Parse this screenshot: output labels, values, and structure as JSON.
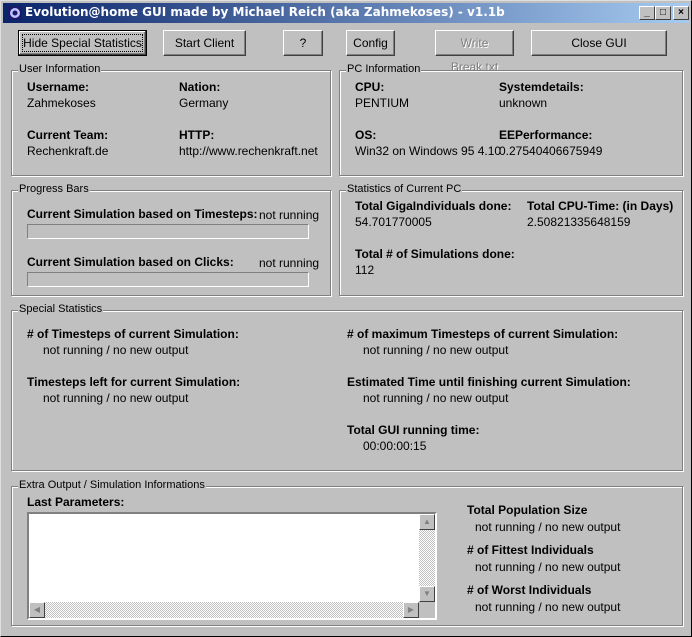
{
  "window": {
    "title": "Evolution@home GUI made by Michael Reich (aka Zahmekoses) - v1.1b",
    "controls": {
      "minimize": "_",
      "maximize": "□",
      "close": "×"
    }
  },
  "toolbar": {
    "hide_special_stats": "Hide Special Statistics",
    "start_client": "Start Client",
    "help": "?",
    "config": "Config",
    "write_break": "Write Break.txt",
    "close_gui": "Close GUI"
  },
  "user_info": {
    "group_label": "User Information",
    "username_label": "Username:",
    "username": "Zahmekoses",
    "nation_label": "Nation:",
    "nation": "Germany",
    "team_label": "Current Team:",
    "team": "Rechenkraft.de",
    "http_label": "HTTP:",
    "http": "http://www.rechenkraft.net"
  },
  "pc_info": {
    "group_label": "PC Information",
    "cpu_label": "CPU:",
    "cpu": "PENTIUM",
    "sysdetails_label": "Systemdetails:",
    "sysdetails": "unknown",
    "os_label": "OS:",
    "os": "Win32 on Windows 95 4.10",
    "eeperf_label": "EEPerformance:",
    "eeperf": "0.27540406675949"
  },
  "progress": {
    "group_label": "Progress Bars",
    "timesteps_label": "Current Simulation based on Timesteps:",
    "timesteps_status": "not running",
    "timesteps_fraction": 0,
    "clicks_label": "Current Simulation based on Clicks:",
    "clicks_status": "not running",
    "clicks_fraction": 0
  },
  "stats_pc": {
    "group_label": "Statistics of Current PC",
    "giga_label": "Total GigaIndividuals done:",
    "giga": "54.701770005",
    "cputime_label": "Total CPU-Time: (in Days)",
    "cputime": "2.50821335648159",
    "sims_label": "Total # of Simulations done:",
    "sims": "112"
  },
  "special": {
    "group_label": "Special Statistics",
    "timesteps_label": "# of Timesteps of current Simulation:",
    "timesteps": "not running / no new output",
    "max_timesteps_label": "# of maximum Timesteps of current Simulation:",
    "max_timesteps": "not running / no new output",
    "left_label": "Timesteps left for current Simulation:",
    "left": "not running / no new output",
    "est_label": "Estimated Time until finishing current Simulation:",
    "est": "not running / no new output",
    "runtime_label": "Total GUI running time:",
    "runtime": "00:00:00:15"
  },
  "extra": {
    "group_label": "Extra Output / Simulation Informations",
    "params_label": "Last Parameters:",
    "params_value": "",
    "pop_label": "Total Population Size",
    "pop": "not running / no new output",
    "fittest_label": "# of Fittest Individuals",
    "fittest": "not running / no new output",
    "worst_label": "# of Worst Individuals",
    "worst": "not running / no new output"
  }
}
